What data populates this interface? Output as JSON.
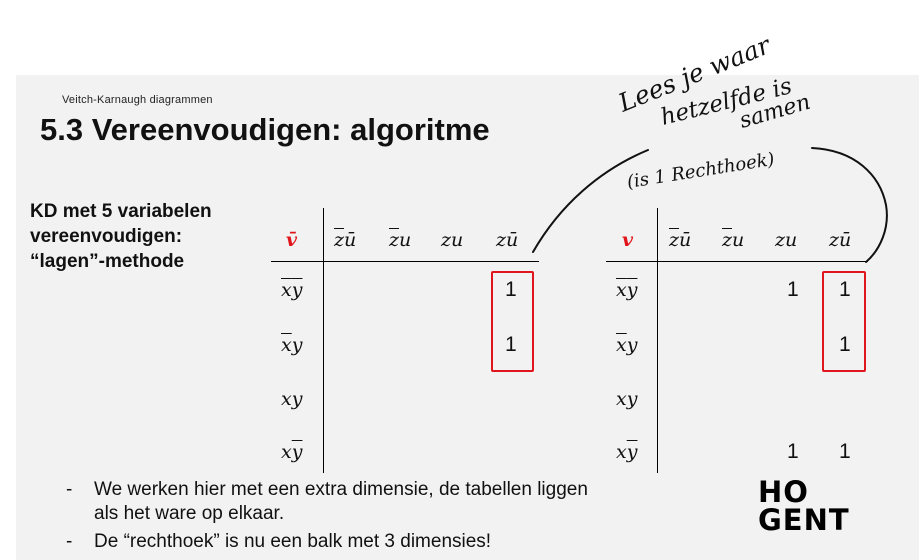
{
  "slide": {
    "section": "Veitch-Karnaugh  diagrammen",
    "title": "5.3 Vereenvoudigen: algoritme",
    "heading_lines": [
      "KD met 5 variabelen",
      "vereenvoudigen:",
      "“lagen”-methode"
    ]
  },
  "kmap_left": {
    "corner": "v̄",
    "cols": [
      {
        "a": "z",
        "b": "ū",
        "bar_a": true,
        "bar_b": true
      },
      {
        "a": "z",
        "b": "u",
        "bar_a": true,
        "bar_b": false
      },
      {
        "a": "z",
        "b": "u",
        "bar_a": false,
        "bar_b": false
      },
      {
        "a": "z",
        "b": "ū",
        "bar_a": false,
        "bar_b": true
      }
    ],
    "rows": [
      {
        "a": "x",
        "b": "y",
        "bar_a": true,
        "bar_b": true
      },
      {
        "a": "x",
        "b": "y",
        "bar_a": true,
        "bar_b": false
      },
      {
        "a": "x",
        "b": "y",
        "bar_a": false,
        "bar_b": false
      },
      {
        "a": "x",
        "b": "y",
        "bar_a": false,
        "bar_b": true
      }
    ],
    "cells": [
      [
        "",
        "",
        "",
        "1"
      ],
      [
        "",
        "",
        "",
        "1"
      ],
      [
        "",
        "",
        "",
        ""
      ],
      [
        "",
        "",
        "",
        ""
      ]
    ]
  },
  "kmap_right": {
    "corner": "v",
    "cells": [
      [
        "",
        "",
        "1",
        "1"
      ],
      [
        "",
        "",
        "",
        "1"
      ],
      [
        "",
        "",
        "",
        ""
      ],
      [
        "",
        "",
        "1",
        "1"
      ]
    ]
  },
  "annotation": {
    "handwritten_lines": [
      "Lees je waar",
      "hetzelfde is",
      "samen",
      "(is 1 Rechthoek)"
    ],
    "ink_color": "#111111"
  },
  "bullets": [
    {
      "dash": "-",
      "text_line1": "We werken hier met een extra dimensie, de tabellen liggen",
      "text_line2": "als het ware op elkaar."
    },
    {
      "dash": "-",
      "text_line1": "De “rechthoek” is nu een balk met 3 dimensies!",
      "text_line2": ""
    }
  ],
  "logo": {
    "line1": "HO",
    "line2": "GENT"
  },
  "colors": {
    "accent": "#e0161c",
    "slide_bg": "#f2f2f2"
  }
}
